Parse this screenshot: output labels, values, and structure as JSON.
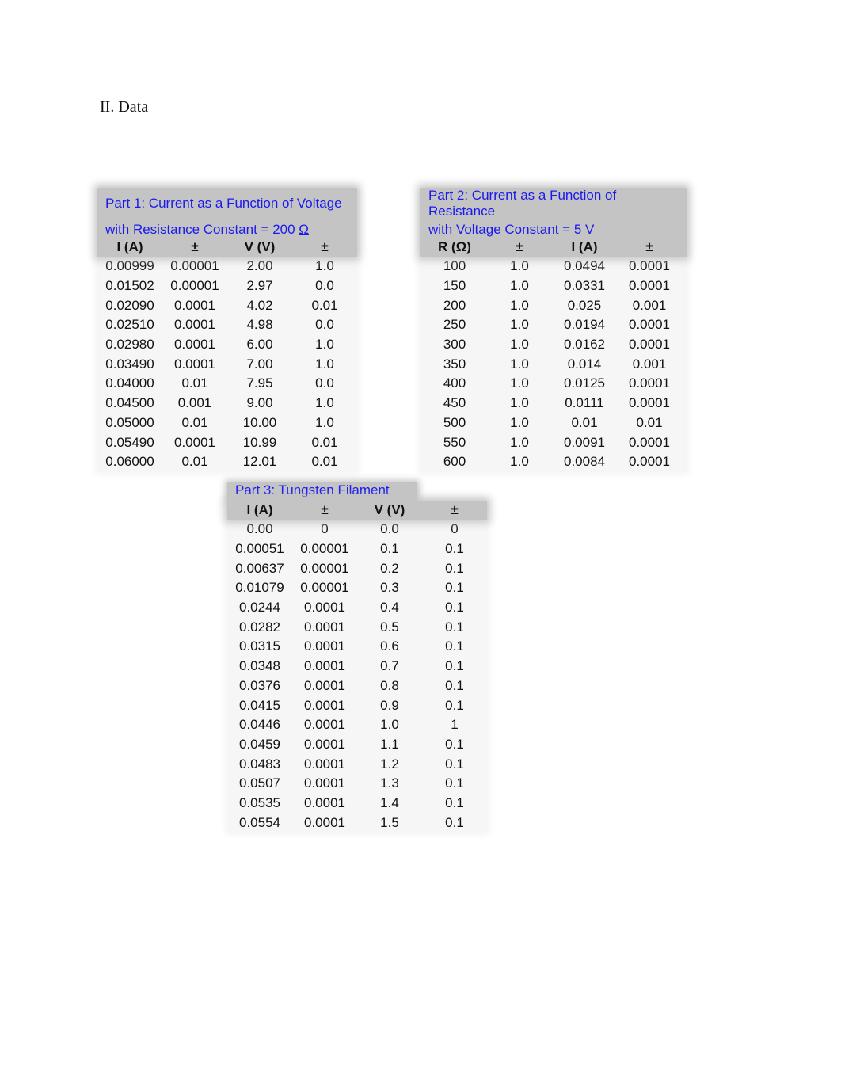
{
  "section_title": "II. Data",
  "part1": {
    "title_line1": "Part 1: Current as a Function of Voltage",
    "title_line2": "with Resistance Constant = 200 ",
    "title_unit": "Ω",
    "headers": [
      "I (A)",
      "±",
      "V (V)",
      "±"
    ],
    "rows": [
      [
        "0.00999",
        "0.00001",
        "2.00",
        "1.0"
      ],
      [
        "0.01502",
        "0.00001",
        "2.97",
        "0.0"
      ],
      [
        "0.02090",
        "0.0001",
        "4.02",
        "0.01"
      ],
      [
        "0.02510",
        "0.0001",
        "4.98",
        "0.0"
      ],
      [
        "0.02980",
        "0.0001",
        "6.00",
        "1.0"
      ],
      [
        "0.03490",
        "0.0001",
        "7.00",
        "1.0"
      ],
      [
        "0.04000",
        "0.01",
        "7.95",
        "0.0"
      ],
      [
        "0.04500",
        "0.001",
        "9.00",
        "1.0"
      ],
      [
        "0.05000",
        "0.01",
        "10.00",
        "1.0"
      ],
      [
        "0.05490",
        "0.0001",
        "10.99",
        "0.01"
      ],
      [
        "0.06000",
        "0.01",
        "12.01",
        "0.01"
      ]
    ]
  },
  "part2": {
    "title_line1": "Part 2: Current as a Function of",
    "title_line2": "Resistance",
    "title_line3": "with Voltage Constant = 5 V",
    "headers": [
      "R (Ω)",
      "±",
      "I (A)",
      "±"
    ],
    "rows": [
      [
        "100",
        "1.0",
        "0.0494",
        "0.0001"
      ],
      [
        "150",
        "1.0",
        "0.0331",
        "0.0001"
      ],
      [
        "200",
        "1.0",
        "0.025",
        "0.001"
      ],
      [
        "250",
        "1.0",
        "0.0194",
        "0.0001"
      ],
      [
        "300",
        "1.0",
        "0.0162",
        "0.0001"
      ],
      [
        "350",
        "1.0",
        "0.014",
        "0.001"
      ],
      [
        "400",
        "1.0",
        "0.0125",
        "0.0001"
      ],
      [
        "450",
        "1.0",
        "0.0111",
        "0.0001"
      ],
      [
        "500",
        "1.0",
        "0.01",
        "0.01"
      ],
      [
        "550",
        "1.0",
        "0.0091",
        "0.0001"
      ],
      [
        "600",
        "1.0",
        "0.0084",
        "0.0001"
      ]
    ]
  },
  "part3": {
    "title_line1": "Part 3: Tungsten Filament",
    "headers": [
      "I (A)",
      "±",
      "V (V)",
      "±"
    ],
    "rows": [
      [
        "0.00",
        "0",
        "0.0",
        "0"
      ],
      [
        "0.00051",
        "0.00001",
        "0.1",
        "0.1"
      ],
      [
        "0.00637",
        "0.00001",
        "0.2",
        "0.1"
      ],
      [
        "0.01079",
        "0.00001",
        "0.3",
        "0.1"
      ],
      [
        "0.0244",
        "0.0001",
        "0.4",
        "0.1"
      ],
      [
        "0.0282",
        "0.0001",
        "0.5",
        "0.1"
      ],
      [
        "0.0315",
        "0.0001",
        "0.6",
        "0.1"
      ],
      [
        "0.0348",
        "0.0001",
        "0.7",
        "0.1"
      ],
      [
        "0.0376",
        "0.0001",
        "0.8",
        "0.1"
      ],
      [
        "0.0415",
        "0.0001",
        "0.9",
        "0.1"
      ],
      [
        "0.0446",
        "0.0001",
        "1.0",
        "1"
      ],
      [
        "0.0459",
        "0.0001",
        "1.1",
        "0.1"
      ],
      [
        "0.0483",
        "0.0001",
        "1.2",
        "0.1"
      ],
      [
        "0.0507",
        "0.0001",
        "1.3",
        "0.1"
      ],
      [
        "0.0535",
        "0.0001",
        "1.4",
        "0.1"
      ],
      [
        "0.0554",
        "0.0001",
        "1.5",
        "0.1"
      ]
    ]
  }
}
